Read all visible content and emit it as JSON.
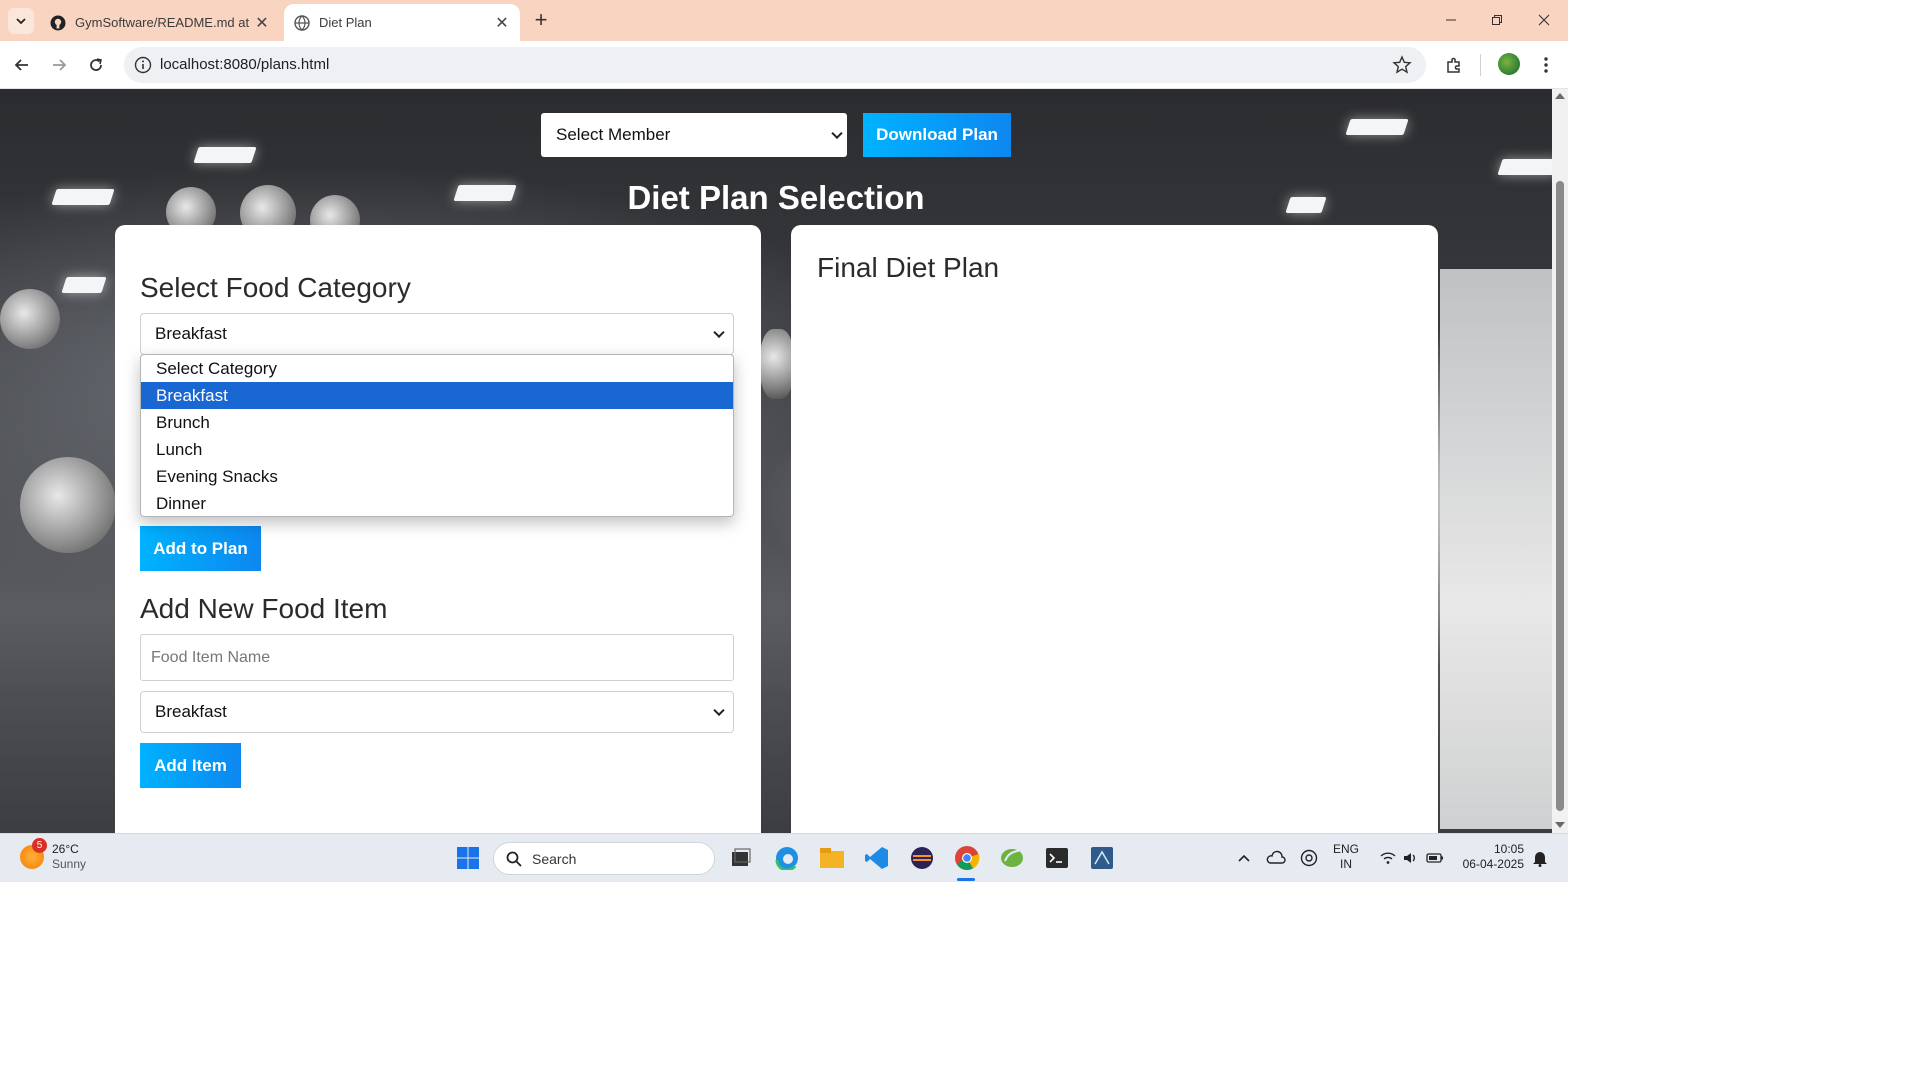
{
  "browser": {
    "tabs": [
      {
        "title": "GymSoftware/README.md at m",
        "active": false
      },
      {
        "title": "Diet Plan",
        "active": true
      }
    ],
    "url": "localhost:8080/plans.html"
  },
  "page": {
    "member_select": "Select Member",
    "download_label": "Download Plan",
    "title": "Diet Plan Selection",
    "left": {
      "heading": "Select Food Category",
      "category_value": "Breakfast",
      "dropdown_options": [
        "Select Category",
        "Breakfast",
        "Brunch",
        "Lunch",
        "Evening Snacks",
        "Dinner"
      ],
      "selected_option": "Breakfast",
      "add_to_plan_label": "Add to Plan",
      "new_item_heading": "Add New Food Item",
      "food_name_placeholder": "Food Item Name",
      "new_item_category": "Breakfast",
      "add_item_label": "Add Item"
    },
    "right": {
      "heading": "Final Diet Plan"
    }
  },
  "taskbar": {
    "weather": {
      "temp": "26°C",
      "condition": "Sunny",
      "badge": "5"
    },
    "search_label": "Search",
    "lang": {
      "line1": "ENG",
      "line2": "IN"
    },
    "time": "10:05",
    "date": "06-04-2025"
  },
  "colors": {
    "tabbar": "#f9d4c0",
    "button_gradient_start": "#00b2ff",
    "button_gradient_end": "#0d87ef",
    "dropdown_highlight": "#1967d2"
  },
  "icons": [
    "tab-search-icon",
    "github-icon",
    "globe-icon",
    "close-icon",
    "plus-icon",
    "minimize-icon",
    "restore-icon",
    "back-icon",
    "forward-icon",
    "reload-icon",
    "info-icon",
    "star-icon",
    "extensions-icon",
    "profile-avatar",
    "menu-icon"
  ]
}
